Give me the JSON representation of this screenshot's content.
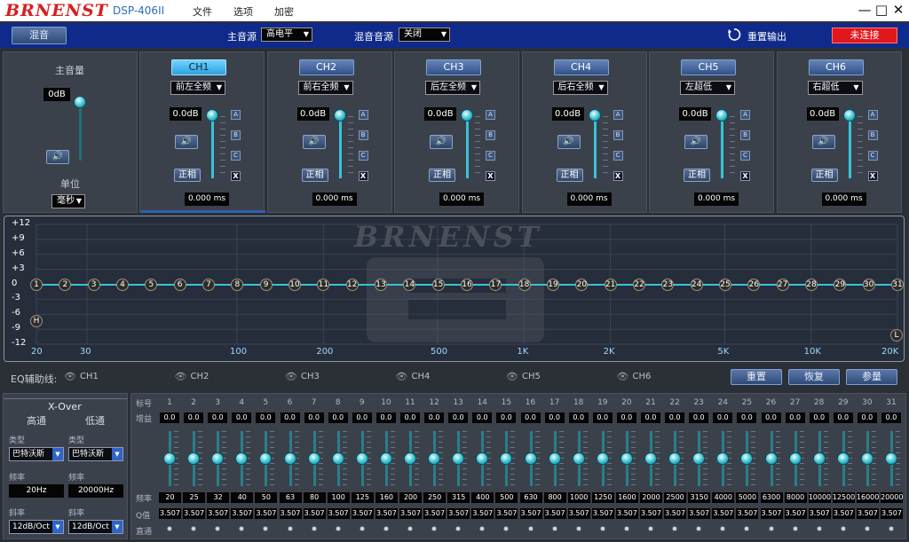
{
  "app": {
    "logo": "BRNENST",
    "model": "DSP-406II",
    "menu": [
      "文件",
      "选项",
      "加密"
    ],
    "win": {
      "min": "—",
      "max": "□",
      "close": "✕"
    }
  },
  "toolbar": {
    "mix": "混音",
    "main_source_label": "主音源",
    "main_source_value": "高电平",
    "mix_source_label": "混音音源",
    "mix_source_value": "关闭",
    "reset_output": "重置输出",
    "connect": "未连接"
  },
  "master": {
    "title": "主音量",
    "db": "0dB",
    "unit_label": "单位",
    "unit_value": "毫秒"
  },
  "channels": [
    {
      "name": "CH1",
      "assign": "前左全频",
      "db": "0.0dB",
      "phase": "正相",
      "delay": "0.000 ms",
      "active": true
    },
    {
      "name": "CH2",
      "assign": "前右全频",
      "db": "0.0dB",
      "phase": "正相",
      "delay": "0.000 ms",
      "active": false
    },
    {
      "name": "CH3",
      "assign": "后左全频",
      "db": "0.0dB",
      "phase": "正相",
      "delay": "0.000 ms",
      "active": false
    },
    {
      "name": "CH4",
      "assign": "后右全频",
      "db": "0.0dB",
      "phase": "正相",
      "delay": "0.000 ms",
      "active": false
    },
    {
      "name": "CH5",
      "assign": "左超低",
      "db": "0.0dB",
      "phase": "正相",
      "delay": "0.000 ms",
      "active": false
    },
    {
      "name": "CH6",
      "assign": "右超低",
      "db": "0.0dB",
      "phase": "正相",
      "delay": "0.000 ms",
      "active": false
    }
  ],
  "abc": [
    "A",
    "B",
    "C",
    "X"
  ],
  "graph": {
    "watermark": "BRNENST",
    "y_ticks": [
      "+12",
      "+9",
      "+6",
      "+3",
      "0",
      "-3",
      "-6",
      "-9",
      "-12"
    ],
    "x_ticks": [
      "20",
      "30",
      "100",
      "200",
      "500",
      "1K",
      "2K",
      "5K",
      "10K",
      "20K"
    ],
    "h_label": "H",
    "l_label": "L"
  },
  "eq_aux": {
    "label": "EQ辅助线:",
    "channels": [
      "CH1",
      "CH2",
      "CH3",
      "CH4",
      "CH5",
      "CH6"
    ],
    "reset": "重置",
    "restore": "恢复",
    "params": "参量"
  },
  "xover": {
    "title": "X-Over",
    "high": "高通",
    "low": "低通",
    "type_label": "类型",
    "type_hp": "巴特沃斯",
    "type_lp": "巴特沃斯",
    "freq_label": "频率",
    "freq_hp": "20Hz",
    "freq_lp": "20000Hz",
    "slope_label": "斜率",
    "slope_hp": "12dB/Oct",
    "slope_lp": "12dB/Oct"
  },
  "eq": {
    "row_index": "标号",
    "row_gain": "增益",
    "row_freq": "频率",
    "row_q": "Q值",
    "row_bypass": "直通",
    "gain": "0.0",
    "q": "3.507",
    "freqs": [
      "20",
      "25",
      "32",
      "40",
      "50",
      "63",
      "80",
      "100",
      "125",
      "160",
      "200",
      "250",
      "315",
      "400",
      "500",
      "630",
      "800",
      "1000",
      "1250",
      "1600",
      "2000",
      "2500",
      "3150",
      "4000",
      "5000",
      "6300",
      "8000",
      "10000",
      "12500",
      "16000",
      "20000"
    ]
  }
}
